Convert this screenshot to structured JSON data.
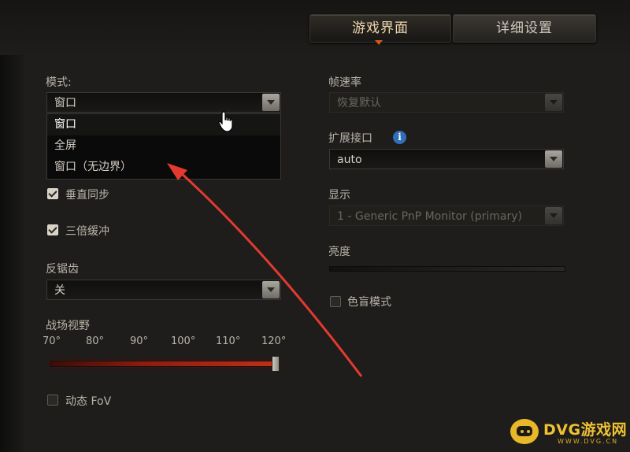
{
  "tabs": [
    {
      "label": "游戏界面",
      "active": true
    },
    {
      "label": "详细设置",
      "active": false
    }
  ],
  "left": {
    "mode": {
      "label": "模式:",
      "value": "窗口",
      "options": [
        "窗口",
        "全屏",
        "窗口（无边界）"
      ]
    },
    "vsync": {
      "label": "垂直同步",
      "checked": true
    },
    "triple_buffer": {
      "label": "三倍缓冲",
      "checked": true
    },
    "anti_aliasing": {
      "label": "反锯齿",
      "value": "关"
    },
    "fov": {
      "label": "战场视野",
      "ticks": [
        "70°",
        "80°",
        "90°",
        "100°",
        "110°",
        "120°"
      ],
      "value_fraction": 1.0
    },
    "dynamic_fov": {
      "label": "动态 FoV",
      "checked": false
    }
  },
  "right": {
    "frame_rate": {
      "label": "帧速率",
      "value": "恢复默认",
      "disabled": true
    },
    "extended_interface": {
      "label": "扩展接口",
      "value": "auto",
      "info_icon": "info-icon"
    },
    "display": {
      "label": "显示",
      "value": "1 - Generic PnP Monitor (primary)",
      "disabled": true
    },
    "brightness": {
      "label": "亮度"
    },
    "colorblind": {
      "label": "色盲模式",
      "checked": false
    }
  },
  "watermark": {
    "title": "DVG游戏网",
    "url": "WWW.DVG.CN"
  },
  "colors": {
    "accent": "#d2581d",
    "arrow": "#e23a2f",
    "slider": "#c23018"
  }
}
